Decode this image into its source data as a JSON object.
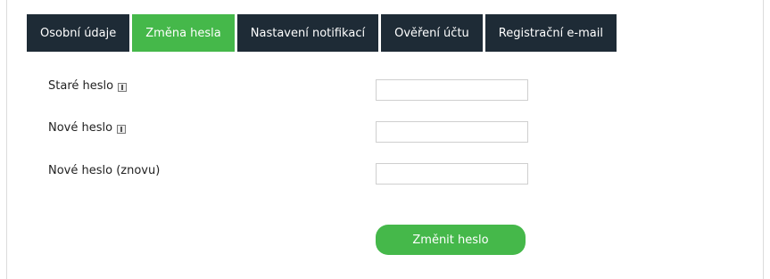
{
  "tabs": [
    {
      "label": "Osobní údaje",
      "active": false
    },
    {
      "label": "Změna hesla",
      "active": true
    },
    {
      "label": "Nastavení notifikací",
      "active": false
    },
    {
      "label": "Ověření účtu",
      "active": false
    },
    {
      "label": "Registrační e-mail",
      "active": false
    }
  ],
  "form": {
    "old_password_label": "Staré heslo",
    "old_password_value": "",
    "new_password_label": "Nové heslo",
    "new_password_value": "",
    "confirm_password_label": "Nové heslo (znovu)",
    "confirm_password_value": "",
    "submit_label": "Změnit heslo"
  },
  "colors": {
    "tab_background": "#1e2b36",
    "tab_active": "#45b84a",
    "button": "#45b84a"
  }
}
